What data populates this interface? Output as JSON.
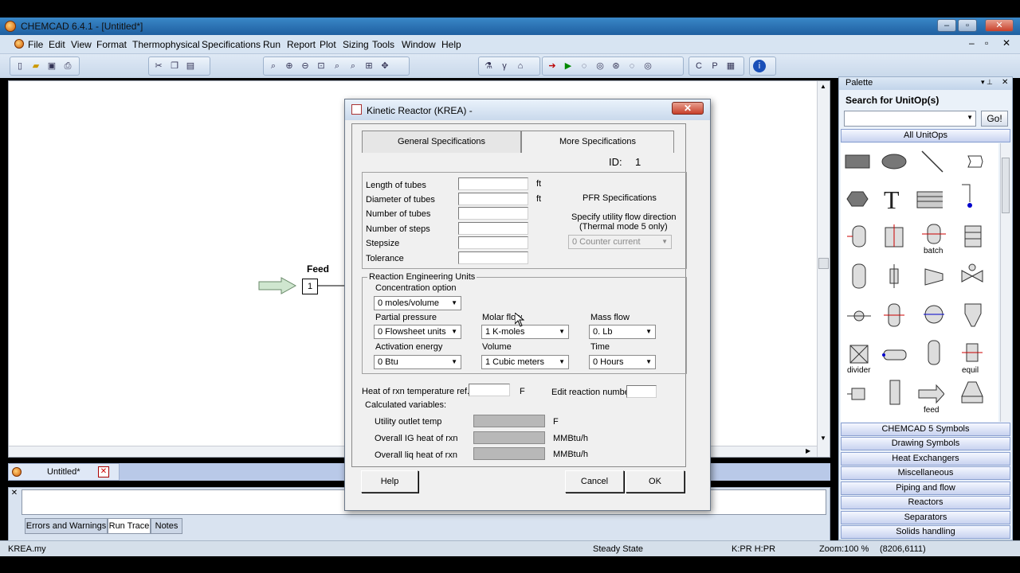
{
  "window": {
    "title": "CHEMCAD 6.4.1 - [Untitled*]"
  },
  "menu": [
    "File",
    "Edit",
    "View",
    "Format",
    "Thermophysical",
    "Specifications",
    "Run",
    "Report",
    "Plot",
    "Sizing",
    "Tools",
    "Window",
    "Help"
  ],
  "canvas": {
    "feed_label": "Feed",
    "stream_id": "1"
  },
  "palette": {
    "title": "Palette",
    "search_label": "Search for UnitOp(s)",
    "search_value": "",
    "go": "Go!",
    "all": "All UnitOps",
    "sym_labels": {
      "batch": "batch",
      "divider": "divider",
      "equil": "equil",
      "feed": "feed"
    },
    "categories": [
      "CHEMCAD 5 Symbols",
      "Drawing Symbols",
      "Heat Exchangers",
      "Miscellaneous",
      "Piping and flow",
      "Reactors",
      "Separators",
      "Solids handling"
    ]
  },
  "doc_tab": {
    "label": "Untitled*"
  },
  "output_tabs": [
    "Errors and Warnings",
    "Run Trace",
    "Notes"
  ],
  "status": {
    "file": "KREA.my",
    "state": "Steady State",
    "kh": "K:PR H:PR",
    "zoom": "Zoom:100 %",
    "coords": "(8206,6111)"
  },
  "dialog": {
    "title": "Kinetic Reactor (KREA) -",
    "tabs": [
      "General Specifications",
      "More Specifications"
    ],
    "id_label": "ID:",
    "id_value": "1",
    "fields": [
      {
        "label": "Length of tubes",
        "unit": "ft",
        "value": ""
      },
      {
        "label": "Diameter of tubes",
        "unit": "ft",
        "value": ""
      },
      {
        "label": "Number of tubes",
        "unit": "",
        "value": ""
      },
      {
        "label": "Number of steps",
        "unit": "",
        "value": ""
      },
      {
        "label": "Stepsize",
        "unit": "",
        "value": ""
      },
      {
        "label": "Tolerance",
        "unit": "",
        "value": ""
      }
    ],
    "pfr_title": "PFR Specifications",
    "pfr_note1": "Specify utility flow direction",
    "pfr_note2": "(Thermal mode 5 only)",
    "pfr_select": "0 Counter current",
    "reu": {
      "legend": "Reaction Engineering Units",
      "conc_label": "Concentration option",
      "conc_value": "0 moles/volume",
      "pp_label": "Partial pressure",
      "pp_value": "0 Flowsheet units",
      "mf_label": "Molar flow",
      "mf_value": "1 K-moles",
      "mass_label": "Mass flow",
      "mass_value": "0. Lb",
      "ae_label": "Activation energy",
      "ae_value": "0 Btu",
      "vol_label": "Volume",
      "vol_value": "1 Cubic meters",
      "time_label": "Time",
      "time_value": "0 Hours"
    },
    "heat_ref_label": "Heat of rxn temperature ref.",
    "heat_ref_unit": "F",
    "heat_ref_value": "",
    "edit_rxn_label": "Edit reaction number",
    "edit_rxn_value": "",
    "calc_label": "Calculated variables:",
    "calc": [
      {
        "label": "Utility outlet temp",
        "unit": "F"
      },
      {
        "label": "Overall  IG heat of rxn",
        "unit": "MMBtu/h"
      },
      {
        "label": "Overall liq heat of rxn",
        "unit": "MMBtu/h"
      }
    ],
    "buttons": {
      "help": "Help",
      "cancel": "Cancel",
      "ok": "OK"
    }
  }
}
